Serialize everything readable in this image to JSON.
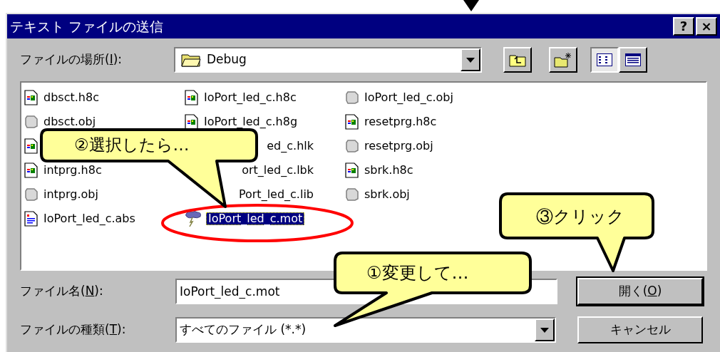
{
  "window": {
    "title": "テキスト ファイルの送信",
    "title_buttons": [
      "?",
      "×"
    ]
  },
  "location": {
    "label_before": "ファイルの場所(",
    "mnemonic": "I",
    "label_after": "):",
    "value": "Debug"
  },
  "view_buttons": [
    {
      "kind": "up"
    },
    {
      "kind": "new-folder"
    },
    {
      "kind": "list",
      "selected": true
    },
    {
      "kind": "details",
      "selected": false
    }
  ],
  "files": [
    {
      "name": "dbsct.h8c",
      "kind": "h8c",
      "selected": false
    },
    {
      "name": "dbsct.obj",
      "kind": "obj",
      "selected": false
    },
    {
      "kind": "h8c",
      "selected": false
    },
    {
      "name": "intprg.h8c",
      "kind": "h8c",
      "selected": false
    },
    {
      "name": "intprg.obj",
      "kind": "obj",
      "selected": false
    },
    {
      "name": "IoPort_led_c.abs",
      "kind": "doc",
      "selected": false
    },
    {
      "name": "IoPort_led_c.h8c",
      "kind": "h8c",
      "selected": false
    },
    {
      "name": "IoPort_led_c.h8g",
      "kind": "h8c",
      "selected": false
    },
    {
      "name": "ed_c.hlk",
      "covered": true,
      "selected": false
    },
    {
      "name": "ort_led_c.lbk",
      "covered": true,
      "selected": false
    },
    {
      "name": "Port_led_c.lib",
      "covered": true,
      "selected": false
    },
    {
      "name": "IoPort_led_c.mot",
      "kind": "mot",
      "selected": true
    },
    {
      "name": "IoPort_led_c.obj",
      "kind": "obj",
      "selected": false
    },
    {
      "name": "resetprg.h8c",
      "kind": "h8c",
      "selected": false
    },
    {
      "name": "resetprg.obj",
      "kind": "obj",
      "selected": false
    },
    {
      "name": "sbrk.h8c",
      "kind": "h8c",
      "selected": false
    },
    {
      "name": "sbrk.obj",
      "kind": "obj",
      "selected": false
    }
  ],
  "filename": {
    "label_before": "ファイル名(",
    "mnemonic": "N",
    "label_after": "):",
    "value": "IoPort_led_c.mot"
  },
  "filetype": {
    "label_before": "ファイルの種類(",
    "mnemonic": "T",
    "label_after": "):",
    "value": "すべてのファイル (*.*)"
  },
  "buttons": [
    {
      "label_before": "開く(",
      "mnemonic": "O",
      "label_after": ")",
      "default": true
    },
    {
      "label": "キャンセル",
      "default": false
    }
  ],
  "callouts": [
    {
      "text": "②選択したら…"
    },
    {
      "text": "③クリック"
    },
    {
      "text": "①変更して…"
    }
  ]
}
